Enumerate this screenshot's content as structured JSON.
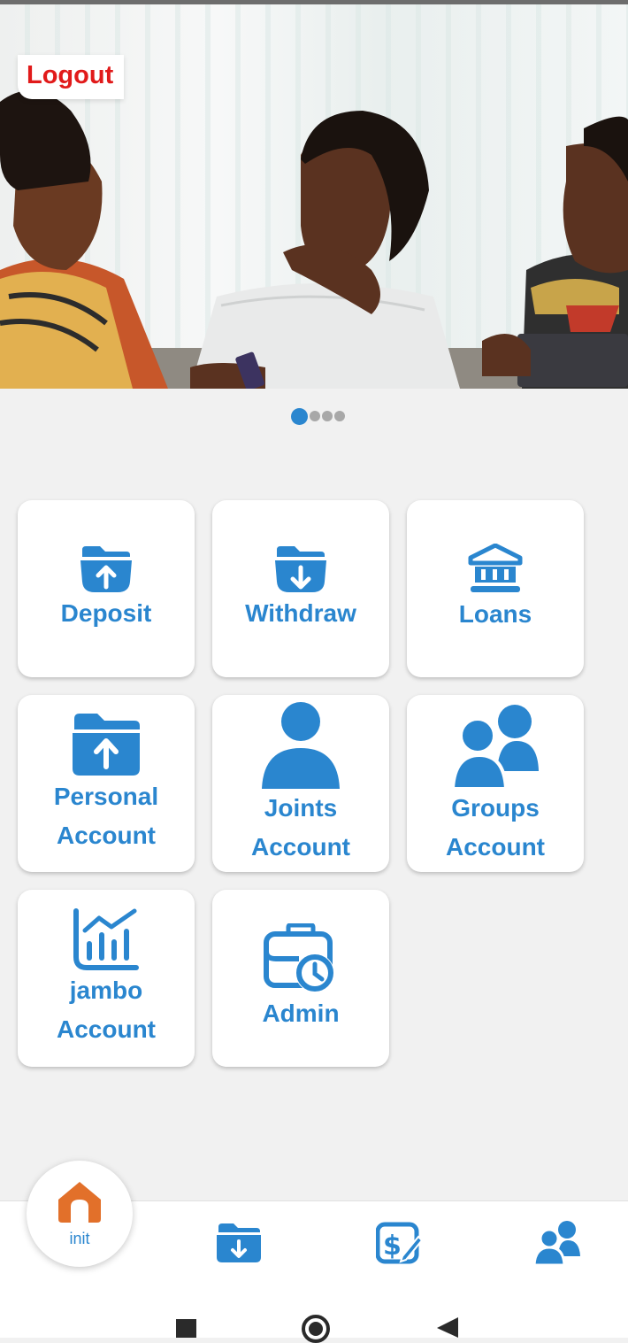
{
  "header": {
    "logout_label": "Logout"
  },
  "carousel": {
    "slides": 4,
    "active_index": 0
  },
  "tiles": [
    {
      "label_lines": [
        "Deposit"
      ],
      "icon": "folder-upload-icon"
    },
    {
      "label_lines": [
        "Withdraw"
      ],
      "icon": "folder-download-icon"
    },
    {
      "label_lines": [
        "Loans"
      ],
      "icon": "bank-icon"
    },
    {
      "label_lines": [
        "Personal",
        "Account"
      ],
      "icon": "folder-upload-icon"
    },
    {
      "label_lines": [
        "Joints",
        "Account"
      ],
      "icon": "user-icon"
    },
    {
      "label_lines": [
        "Groups",
        "Account"
      ],
      "icon": "users-icon"
    },
    {
      "label_lines": [
        "jambo",
        "Account"
      ],
      "icon": "chart-icon"
    },
    {
      "label_lines": [
        "Admin"
      ],
      "icon": "briefcase-clock-icon"
    }
  ],
  "bottom_nav": {
    "home_label": "init",
    "items": [
      "home-icon",
      "folder-download-icon",
      "money-edit-icon",
      "users-icon"
    ]
  },
  "colors": {
    "accent": "#2a86cf",
    "logout": "#e11a1a",
    "home": "#e2702a"
  }
}
